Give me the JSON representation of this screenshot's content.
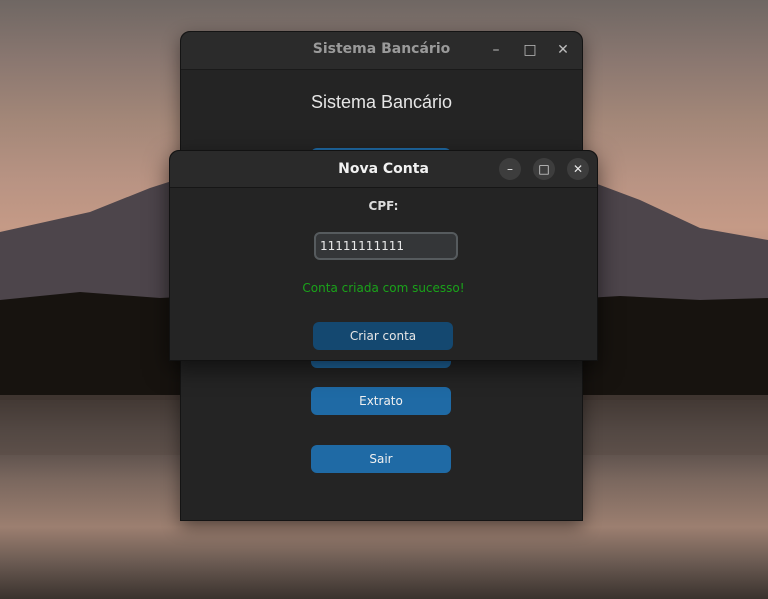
{
  "main_window": {
    "title": "Sistema Bancário",
    "heading": "Sistema Bancário",
    "buttons": {
      "extrato": "Extrato",
      "sair": "Sair"
    },
    "controls": {
      "minimize": "–",
      "maximize": "□",
      "close": "✕"
    }
  },
  "dialog": {
    "title": "Nova Conta",
    "cpf_label": "CPF:",
    "cpf_value": "11111111111",
    "success_message": "Conta criada com sucesso!",
    "create_button": "Criar conta",
    "controls": {
      "minimize": "–",
      "maximize": "□",
      "close": "✕"
    }
  },
  "colors": {
    "accent_button": "#1f6aa5",
    "success_text": "#1aa31a"
  }
}
